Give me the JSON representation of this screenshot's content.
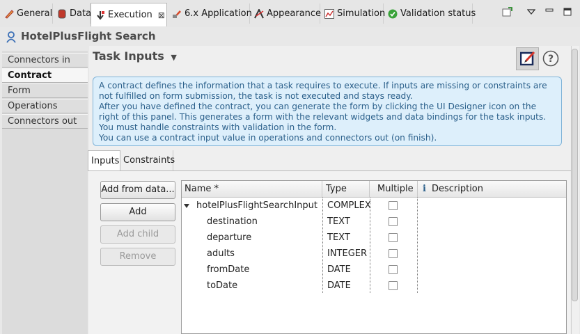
{
  "tabs": [
    {
      "label": "General",
      "icon": "pencil-icon"
    },
    {
      "label": "Data",
      "icon": "database-icon"
    },
    {
      "label": "Execution",
      "icon": "execution-arrow-icon"
    },
    {
      "label": "6.x Application",
      "icon": "application-icon"
    },
    {
      "label": "Appearance",
      "icon": "appearance-icon"
    },
    {
      "label": "Simulation",
      "icon": "chart-icon"
    },
    {
      "label": "Validation status",
      "icon": "check-circle-icon"
    }
  ],
  "active_tab": "Execution",
  "close_glyph": "⊠",
  "title": "HotelPlusFlight Search",
  "nav": [
    "Connectors in",
    "Contract",
    "Form",
    "Operations",
    "Connectors out"
  ],
  "nav_selected": "Contract",
  "section_title": "Task Inputs",
  "info_lines": [
    "A contract defines the information that a task requires to execute. If inputs are missing or constraints are",
    "not fulfilled on form submission, the task is not executed and stays ready.",
    "After you have defined the contract, you can generate the form by clicking the UI Designer icon on the",
    "right of this panel. This generates a form with the relevant widgets and data bindings for the task inputs.",
    "You must handle constraints with validation in the form.",
    "You can use a contract input value in operations and connectors out (on finish)."
  ],
  "subtabs": [
    "Inputs",
    "Constraints"
  ],
  "buttons": {
    "add_from_data": "Add from data...",
    "add": "Add",
    "add_child": "Add child",
    "remove": "Remove"
  },
  "columns": {
    "name": "Name *",
    "type": "Type",
    "multiple": "Multiple",
    "description": "Description"
  },
  "rows": [
    {
      "name": "hotelPlusFlightSearchInput",
      "type": "COMPLEX",
      "multiple": false,
      "expanded": true
    },
    {
      "name": "destination",
      "type": "TEXT",
      "multiple": false
    },
    {
      "name": "departure",
      "type": "TEXT",
      "multiple": false
    },
    {
      "name": "adults",
      "type": "INTEGER",
      "multiple": false
    },
    {
      "name": "fromDate",
      "type": "DATE",
      "multiple": false
    },
    {
      "name": "toDate",
      "type": "DATE",
      "multiple": false
    }
  ],
  "colors": {
    "accent_blue": "#2a5f8a",
    "info_bg": "#ddeffb",
    "info_border": "#7fb3d8"
  }
}
